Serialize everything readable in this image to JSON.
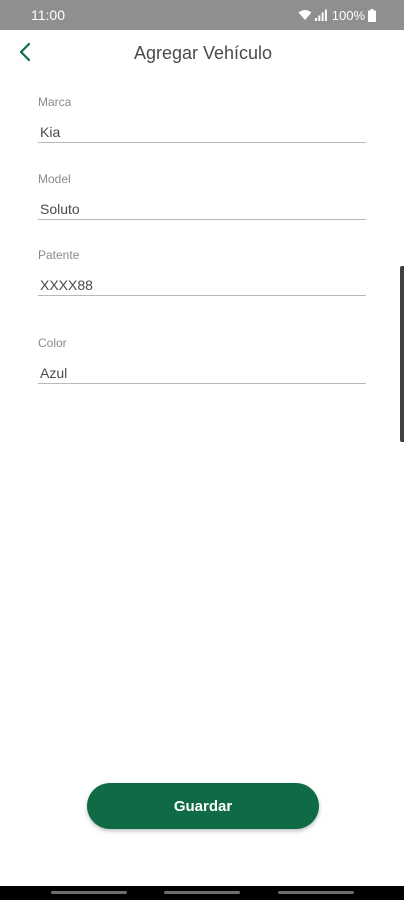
{
  "status_bar": {
    "time": "11:00",
    "battery": "100%",
    "icons": [
      "wifi-icon",
      "signal-icon",
      "battery-icon"
    ]
  },
  "header": {
    "title": "Agregar Vehículo",
    "back_icon": "chevron-left-icon"
  },
  "form": {
    "fields": [
      {
        "label": "Marca",
        "value": "Kia"
      },
      {
        "label": "Model",
        "value": "Soluto"
      },
      {
        "label": "Patente",
        "value": "XXXX88"
      },
      {
        "label": "Color",
        "value": "Azul"
      }
    ]
  },
  "actions": {
    "save_label": "Guardar"
  },
  "colors": {
    "brand_green": "#0f6b45",
    "status_bar": "#8f8f8f",
    "title_text": "#4a4a4a",
    "label_text": "#8a8a8a"
  }
}
